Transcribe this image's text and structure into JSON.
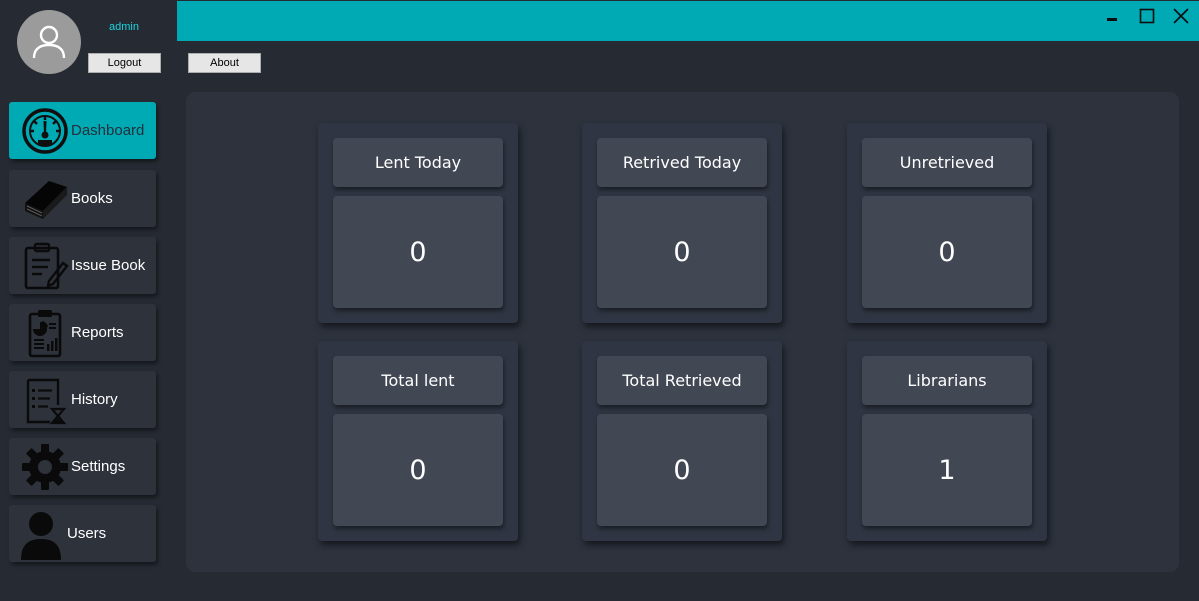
{
  "header": {
    "username": "admin",
    "logout_label": "Logout",
    "about_label": "About",
    "accent_color": "#00aab5"
  },
  "window_controls": {
    "minimize": "▁",
    "maximize": "☐",
    "close": "✕"
  },
  "sidebar": {
    "items": [
      {
        "label": "Dashboard",
        "icon": "dashboard-gauge-icon",
        "active": true
      },
      {
        "label": "Books",
        "icon": "book-icon",
        "active": false
      },
      {
        "label": "Issue Book",
        "icon": "clipboard-pencil-icon",
        "active": false
      },
      {
        "label": "Reports",
        "icon": "report-icon",
        "active": false
      },
      {
        "label": "History",
        "icon": "history-hourglass-icon",
        "active": false
      },
      {
        "label": "Settings",
        "icon": "gear-icon",
        "active": false
      },
      {
        "label": "Users",
        "icon": "user-icon",
        "active": false
      }
    ]
  },
  "stats": {
    "cards": [
      {
        "title": "Lent Today",
        "value": "0"
      },
      {
        "title": "Retrived Today",
        "value": "0"
      },
      {
        "title": "Unretrieved",
        "value": "0"
      },
      {
        "title": "Total lent",
        "value": "0"
      },
      {
        "title": "Total Retrieved",
        "value": "0"
      },
      {
        "title": "Librarians",
        "value": "1"
      }
    ]
  }
}
